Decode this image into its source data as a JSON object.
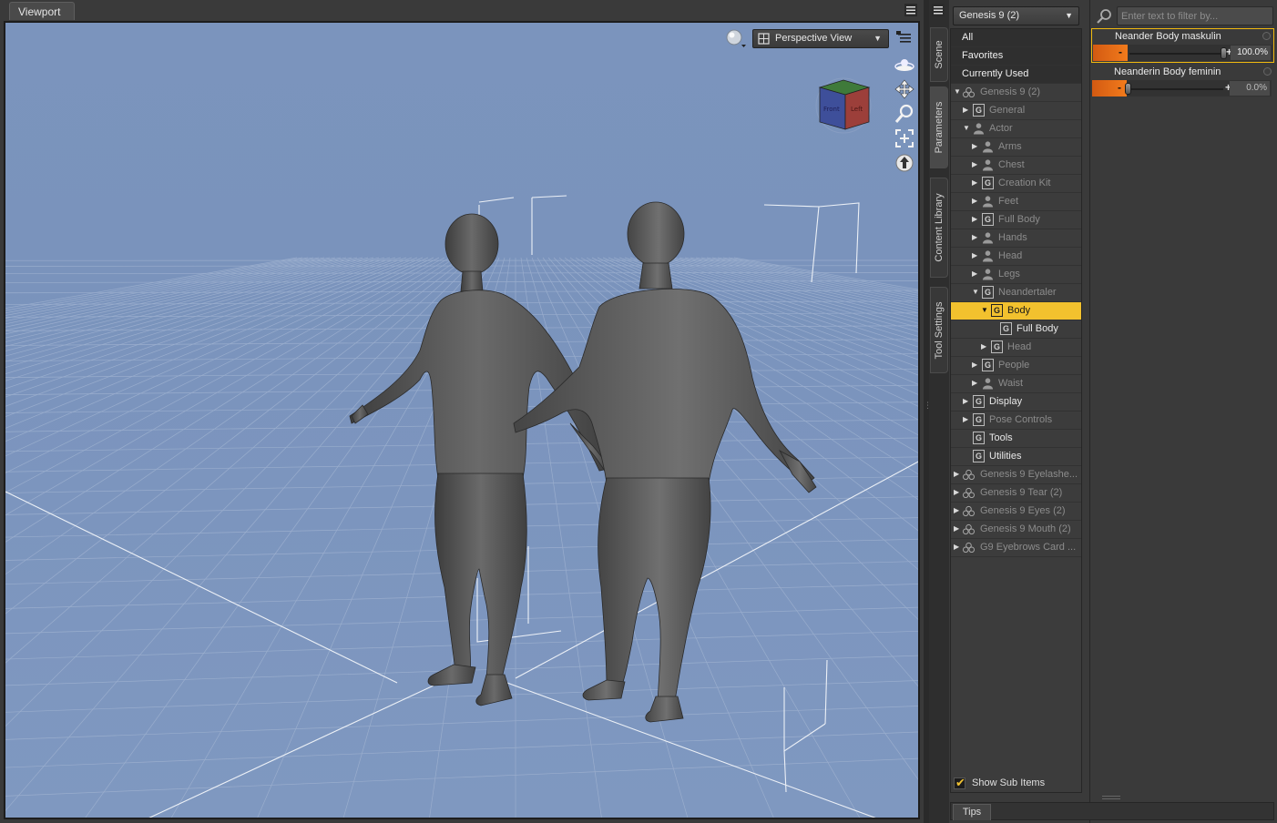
{
  "viewport": {
    "tab_label": "Viewport",
    "view_select": "Perspective View",
    "view_cube_faces": [
      "Front",
      "Left"
    ]
  },
  "side_tabs": [
    "Scene",
    "Parameters",
    "Content Library",
    "Tool Settings"
  ],
  "tree": {
    "figure_select": "Genesis 9 (2)",
    "top_items": [
      "All",
      "Favorites",
      "Currently Used"
    ],
    "rows": [
      {
        "label": "Genesis 9 (2)"
      },
      {
        "label": "General"
      },
      {
        "label": "Actor"
      },
      {
        "label": "Arms"
      },
      {
        "label": "Chest"
      },
      {
        "label": "Creation Kit"
      },
      {
        "label": "Feet"
      },
      {
        "label": "Full Body"
      },
      {
        "label": "Hands"
      },
      {
        "label": "Head"
      },
      {
        "label": "Legs"
      },
      {
        "label": "Neandertaler"
      },
      {
        "label": "Body"
      },
      {
        "label": "Full Body"
      },
      {
        "label": "Head"
      },
      {
        "label": "People"
      },
      {
        "label": "Waist"
      },
      {
        "label": "Display"
      },
      {
        "label": "Pose Controls"
      },
      {
        "label": "Tools"
      },
      {
        "label": "Utilities"
      },
      {
        "label": "Genesis 9 Eyelashe..."
      },
      {
        "label": "Genesis 9 Tear (2)"
      },
      {
        "label": "Genesis 9 Eyes (2)"
      },
      {
        "label": "Genesis 9 Mouth (2)"
      },
      {
        "label": "G9 Eyebrows Card ..."
      }
    ],
    "show_sub_items": "Show Sub Items"
  },
  "properties": {
    "search_placeholder": "Enter text to filter by...",
    "sliders": [
      {
        "name": "Neander Body maskulin",
        "value_text": "100.0%",
        "value": 1.0
      },
      {
        "name": "Neanderin Body feminin",
        "value_text": "0.0%",
        "value": 0.0
      }
    ]
  },
  "footer": {
    "tips": "Tips"
  },
  "colors": {
    "selected": "#f2c12e",
    "slider_fill": "#f27b1c",
    "viewport_bg": "#7b94bd"
  }
}
